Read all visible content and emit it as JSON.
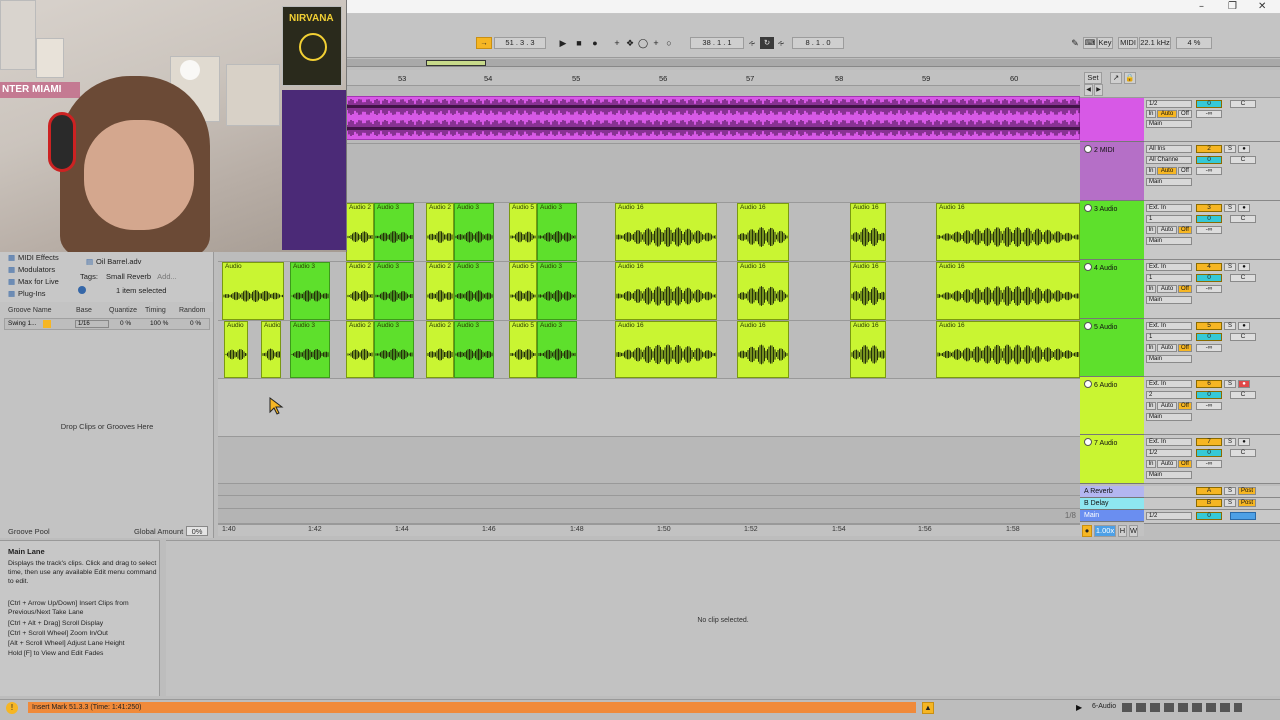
{
  "window": {
    "minimize": "–",
    "restore": "❐",
    "close": "✕"
  },
  "controlbar": {
    "position": "51 .  3 .  3",
    "loop_start": "38 .  1 .  1",
    "loop_length": "8 .  1 .  0",
    "key_label": "Key",
    "midi_label": "MIDI",
    "sample_rate": "22.1 kHz",
    "cpu": "4 %"
  },
  "ruler": {
    "bars": [
      "53",
      "54",
      "55",
      "56",
      "57",
      "58",
      "59",
      "60"
    ]
  },
  "ruler_right": {
    "set_label": "Set"
  },
  "browser": {
    "items": [
      "MIDI Effects",
      "Modulators",
      "Max for Live",
      "Plug-Ins"
    ],
    "file_name": "Oil Barrel.adv",
    "tags_label": "Tags:",
    "tag_value": "Small Reverb",
    "tag_add": "Add...",
    "selection_info": "1 item selected"
  },
  "groove": {
    "headers": [
      "Groove Name",
      "Base",
      "Quantize",
      "Timing",
      "Random"
    ],
    "row": {
      "name": "Swing 1...",
      "base": "1/16",
      "quantize": "0 %",
      "timing": "100 %",
      "random": "0 %"
    },
    "drop_text": "Drop Clips or Grooves Here",
    "footer_label": "Groove Pool",
    "global_amount_label": "Global Amount",
    "global_amount_value": "0%"
  },
  "tracks": [
    {
      "name": "",
      "color": "#d759e6",
      "in": "1/2",
      "out": "Main",
      "num": "",
      "vol": "0",
      "pan": "C",
      "db": "-∞"
    },
    {
      "name": "2 MIDI",
      "color": "#b56fc7",
      "in": "All Ins",
      "in2": "All Channe",
      "out": "Main",
      "num": "2",
      "vol": "0",
      "pan": "C",
      "db": "-∞"
    },
    {
      "name": "3 Audio",
      "color": "#5ee02c",
      "in": "Ext. In",
      "in2": "1",
      "out": "Main",
      "num": "3",
      "vol": "0",
      "pan": "C",
      "db": "-∞"
    },
    {
      "name": "4 Audio",
      "color": "#5ee02c",
      "in": "Ext. In",
      "in2": "1",
      "out": "Main",
      "num": "4",
      "vol": "0",
      "pan": "C",
      "db": "-∞"
    },
    {
      "name": "5 Audio",
      "color": "#5ee02c",
      "in": "Ext. In",
      "in2": "1",
      "out": "Main",
      "num": "5",
      "vol": "0",
      "pan": "C",
      "db": "-∞"
    },
    {
      "name": "6 Audio",
      "color": "#c9f532",
      "in": "Ext. In",
      "in2": "2",
      "out": "Main",
      "num": "6",
      "vol": "0",
      "pan": "C",
      "db": "-∞"
    },
    {
      "name": "7 Audio",
      "color": "#c9f532",
      "in": "Ext. In",
      "in2": "1/2",
      "out": "Main",
      "num": "7",
      "vol": "0",
      "pan": "C",
      "db": "-∞"
    }
  ],
  "monitor": {
    "in": "In",
    "auto": "Auto",
    "off": "Off"
  },
  "returns": [
    {
      "name": "A Reverb",
      "num": "A",
      "post": "Post",
      "color": "#b3b6f0"
    },
    {
      "name": "B Delay",
      "num": "B",
      "post": "Post",
      "color": "#8ee6f0"
    },
    {
      "name": "Main",
      "num": "",
      "post": "",
      "color": "#6a8ef0",
      "out": "1/2",
      "vol": "0"
    }
  ],
  "clip_labels": {
    "audio": "Audio",
    "audio2": "Audio 2",
    "audio3": "Audio 3",
    "audio5": "Audio 5",
    "audio16": "Audio 16"
  },
  "time_ruler": [
    "1:40",
    "1:42",
    "1:44",
    "1:46",
    "1:48",
    "1:50",
    "1:52",
    "1:54",
    "1:56",
    "1:58"
  ],
  "zoom_fraction": "1/8",
  "bottom_right": {
    "zoom": "1.00x",
    "h": "H",
    "w": "W"
  },
  "info": {
    "title": "Main Lane",
    "lines": [
      "Displays the track's clips. Click and drag to select time, then use any available Edit menu command to edit.",
      "",
      "[Ctrl + Arrow Up/Down] Insert Clips from Previous/Next Take Lane",
      "[Ctrl + Alt + Drag] Scroll Display",
      "[Ctrl + Scroll Wheel] Zoom In/Out",
      "[Alt + Scroll Wheel] Adjust Lane Height",
      "Hold [F] to View and Edit Fades"
    ]
  },
  "detail": {
    "no_clip": "No clip selected."
  },
  "status": {
    "message": "Insert Mark 51.3.3 (Time: 1:41:250)",
    "track": "6-Audio"
  },
  "webcam_poster_text": "NIRVANA",
  "webcam_wall_text": "NTER MIAMI"
}
